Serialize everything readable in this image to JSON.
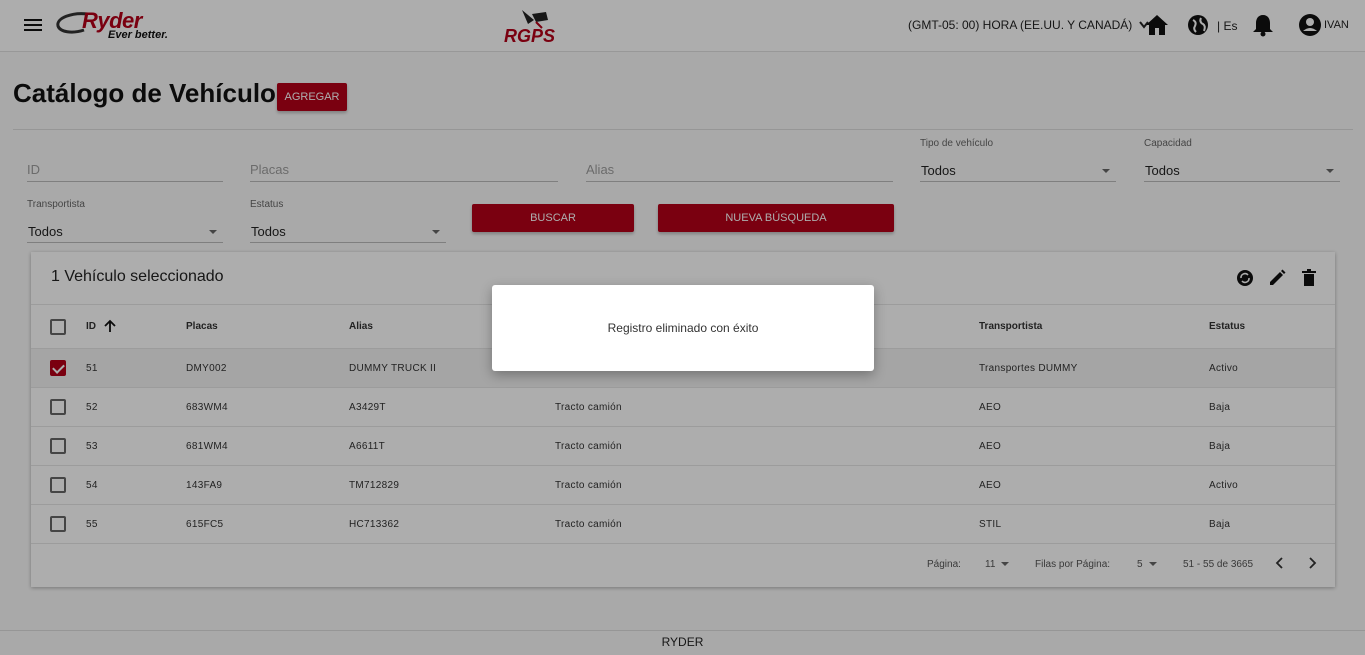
{
  "header": {
    "brand": "Ryder",
    "brand_tagline": "Ever better.",
    "product": "RGPS",
    "timezone": "(GMT-05: 00) HORA (EE.UU. Y CANADÁ)",
    "language": "| Es",
    "user": "IVAN"
  },
  "page": {
    "title": "Catálogo de Vehículos",
    "add_button": "AGREGAR"
  },
  "filters": {
    "id_placeholder": "ID",
    "placas_placeholder": "Placas",
    "alias_placeholder": "Alias",
    "tipo_label": "Tipo de vehículo",
    "tipo_value": "Todos",
    "capacidad_label": "Capacidad",
    "capacidad_value": "Todos",
    "transportista_label": "Transportista",
    "transportista_value": "Todos",
    "estatus_label": "Estatus",
    "estatus_value": "Todos",
    "search_button": "BUSCAR",
    "new_search_button": "NUEVA BÚSQUEDA"
  },
  "table": {
    "selection_title": "1 Vehículo seleccionado",
    "columns": [
      "ID",
      "Placas",
      "Alias",
      "Transportista",
      "Estatus"
    ],
    "rows": [
      {
        "id": "51",
        "placas": "DMY002",
        "alias": "DUMMY TRUCK II",
        "tipo": "",
        "transportista": "Transportes DUMMY",
        "estatus": "Activo",
        "selected": true
      },
      {
        "id": "52",
        "placas": "683WM4",
        "alias": "A3429T",
        "tipo": "Tracto camión",
        "transportista": "AEO",
        "estatus": "Baja",
        "selected": false
      },
      {
        "id": "53",
        "placas": "681WM4",
        "alias": "A6611T",
        "tipo": "Tracto camión",
        "transportista": "AEO",
        "estatus": "Baja",
        "selected": false
      },
      {
        "id": "54",
        "placas": "143FA9",
        "alias": "TM712829",
        "tipo": "Tracto camión",
        "transportista": "AEO",
        "estatus": "Activo",
        "selected": false
      },
      {
        "id": "55",
        "placas": "615FC5",
        "alias": "HC713362",
        "tipo": "Tracto camión",
        "transportista": "STIL",
        "estatus": "Baja",
        "selected": false
      }
    ],
    "pagination": {
      "page_label": "Página:",
      "page_value": "11",
      "rows_label": "Filas por Página:",
      "rows_value": "5",
      "range": "51 - 55 de 3665"
    }
  },
  "footer": {
    "text": "RYDER"
  },
  "dialog": {
    "message": "Registro eliminado con éxito"
  },
  "colors": {
    "brand_red": "#b40019",
    "overlay": "rgba(0,0,0,0.32)"
  }
}
